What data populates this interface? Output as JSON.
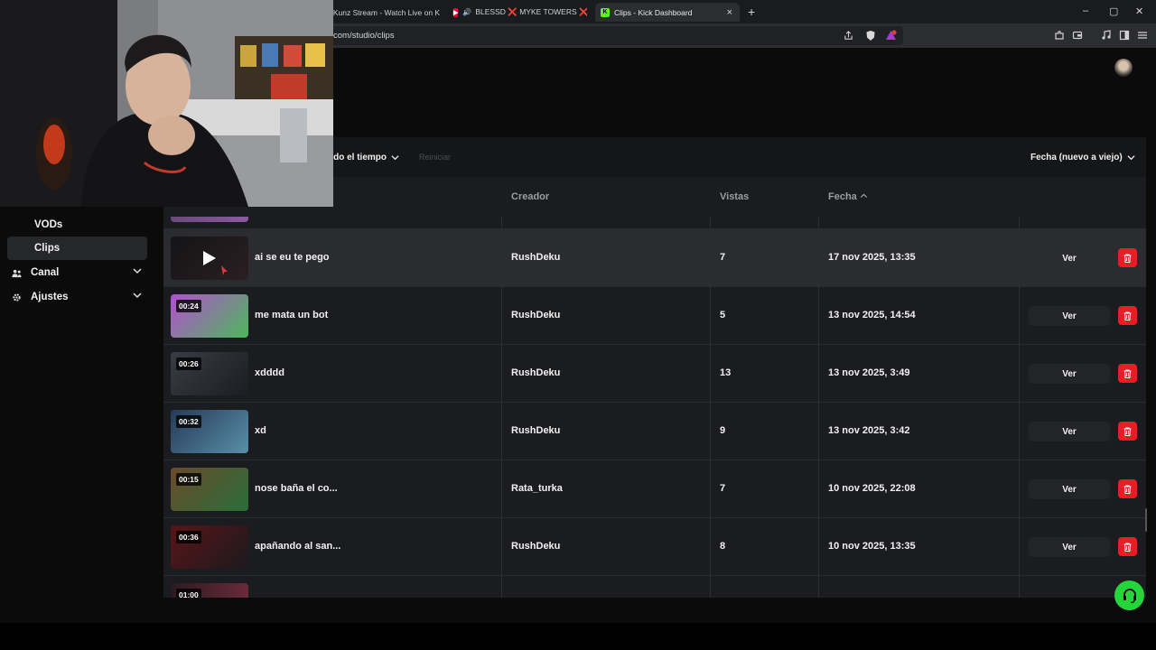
{
  "browser": {
    "tabs": [
      {
        "label": "rKunz Stream - Watch Live on K",
        "color": "#53fc18"
      },
      {
        "label": "BLESSD ❌ MYKE TOWERS ❌ C",
        "color": "#ff0033"
      },
      {
        "label": "Clips - Kick Dashboard",
        "color": "#53fc18",
        "active": true
      }
    ],
    "tab_close": "×",
    "new_tab": "+",
    "url": "com/studio/clips",
    "window_controls": {
      "minimize": "–",
      "maximize": "▢",
      "close": "✕"
    }
  },
  "sidebar": {
    "items": [
      {
        "label": "VODs",
        "icon": "",
        "active": false
      },
      {
        "label": "Clips",
        "icon": "",
        "active": true
      },
      {
        "label": "Canal",
        "icon": "channel-icon",
        "expandable": true
      },
      {
        "label": "Ajustes",
        "icon": "gear-icon",
        "expandable": true
      }
    ]
  },
  "filters": {
    "time_range": "odo el tiempo",
    "restart": "Reiniciar",
    "sort": "Fecha (nuevo a viejo)"
  },
  "table": {
    "headers": {
      "creator": "Creador",
      "views": "Vistas",
      "date": "Fecha"
    },
    "partial_row": {
      "duration": "01:00"
    },
    "rows": [
      {
        "title": "ai se eu te pego",
        "creator": "RushDeku",
        "views": "7",
        "date": "17 nov 2025, 13:35",
        "duration": "",
        "hover": true,
        "thumb_a": "#141416",
        "thumb_b": "#2a1f22"
      },
      {
        "title": "me mata un bot",
        "creator": "RushDeku",
        "views": "5",
        "date": "13 nov 2025, 14:54",
        "duration": "00:24",
        "hover": false,
        "thumb_a": "#b44fd0",
        "thumb_b": "#4bb85a"
      },
      {
        "title": "xdddd",
        "creator": "RushDeku",
        "views": "13",
        "date": "13 nov 2025, 3:49",
        "duration": "00:26",
        "hover": false,
        "thumb_a": "#3a3c44",
        "thumb_b": "#1c1d22"
      },
      {
        "title": "xd",
        "creator": "RushDeku",
        "views": "9",
        "date": "13 nov 2025, 3:42",
        "duration": "00:32",
        "hover": false,
        "thumb_a": "#253a58",
        "thumb_b": "#5a8fa8"
      },
      {
        "title": "nose baña el co...",
        "creator": "Rata_turka",
        "views": "7",
        "date": "10 nov 2025, 22:08",
        "duration": "00:15",
        "hover": false,
        "thumb_a": "#6a4a2a",
        "thumb_b": "#2a6e3a"
      },
      {
        "title": "apañando al san...",
        "creator": "RushDeku",
        "views": "8",
        "date": "10 nov 2025, 13:35",
        "duration": "00:36",
        "hover": false,
        "thumb_a": "#5a1418",
        "thumb_b": "#1a1a1e"
      }
    ],
    "view_label": "Ver"
  },
  "colors": {
    "accent_green": "#24d63a",
    "delete_red": "#e41f26",
    "panel_bg": "#1b1c1f"
  }
}
